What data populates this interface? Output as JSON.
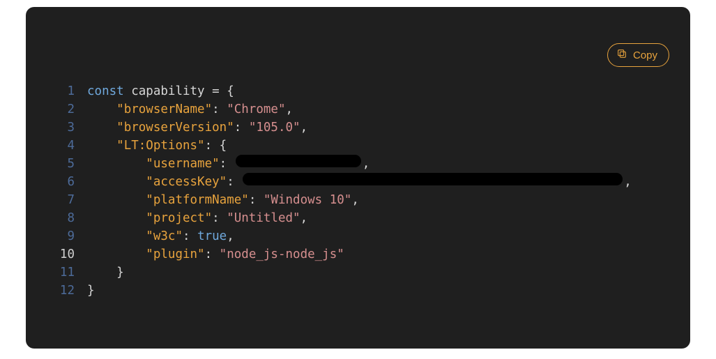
{
  "copy_label": "Copy",
  "code": {
    "lines": {
      "l1": {
        "n": "1",
        "kw": "const",
        "id": "capability",
        "eq": " = {"
      },
      "l2": {
        "n": "2",
        "ind": "    ",
        "key": "\"browserName\"",
        "colon": ": ",
        "val": "\"Chrome\"",
        "tail": ","
      },
      "l3": {
        "n": "3",
        "ind": "    ",
        "key": "\"browserVersion\"",
        "colon": ": ",
        "val": "\"105.0\"",
        "tail": ","
      },
      "l4": {
        "n": "4",
        "ind": "    ",
        "key": "\"LT:Options\"",
        "colon": ": {",
        "val": "",
        "tail": ""
      },
      "l5": {
        "n": "5",
        "ind": "        ",
        "key": "\"username\"",
        "colon": ": ",
        "tail": ","
      },
      "l6": {
        "n": "6",
        "ind": "        ",
        "key": "\"accessKey\"",
        "colon": ": ",
        "tail": ","
      },
      "l7": {
        "n": "7",
        "ind": "        ",
        "key": "\"platformName\"",
        "colon": ": ",
        "val": "\"Windows 10\"",
        "tail": ","
      },
      "l8": {
        "n": "8",
        "ind": "        ",
        "key": "\"project\"",
        "colon": ": ",
        "val": "\"Untitled\"",
        "tail": ","
      },
      "l9": {
        "n": "9",
        "ind": "        ",
        "key": "\"w3c\"",
        "colon": ": ",
        "bool": "true",
        "tail": ","
      },
      "l10": {
        "n": "10",
        "ind": "        ",
        "key": "\"plugin\"",
        "colon": ": ",
        "val": "\"node_js-node_js\"",
        "tail": ""
      },
      "l11": {
        "n": "11",
        "ind": "    ",
        "brace": "}"
      },
      "l12": {
        "n": "12",
        "brace": "}"
      }
    }
  }
}
